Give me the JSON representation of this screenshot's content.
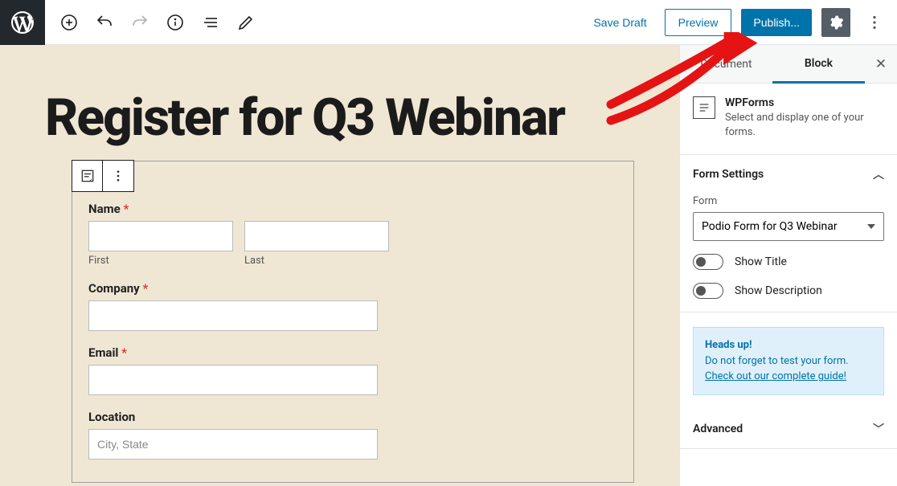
{
  "toolbar": {
    "save_draft": "Save Draft",
    "preview": "Preview",
    "publish": "Publish..."
  },
  "editor": {
    "title": "Register for Q3 Webinar"
  },
  "form": {
    "name_label": "Name",
    "first_sub": "First",
    "last_sub": "Last",
    "company_label": "Company",
    "email_label": "Email",
    "location_label": "Location",
    "location_placeholder": "City, State",
    "required_glyph": "*"
  },
  "sidebar": {
    "tabs": {
      "document": "Document",
      "block": "Block"
    },
    "block_header": {
      "title": "WPForms",
      "desc": "Select and display one of your forms."
    },
    "panels": {
      "form_settings": {
        "title": "Form Settings",
        "form_label": "Form",
        "form_selected": "Podio Form for Q3 Webinar",
        "show_title": "Show Title",
        "show_desc": "Show Description"
      },
      "advanced": {
        "title": "Advanced"
      }
    },
    "notice": {
      "head": "Heads up!",
      "body": "Do not forget to test your form.",
      "link": "Check out our complete guide!"
    }
  }
}
